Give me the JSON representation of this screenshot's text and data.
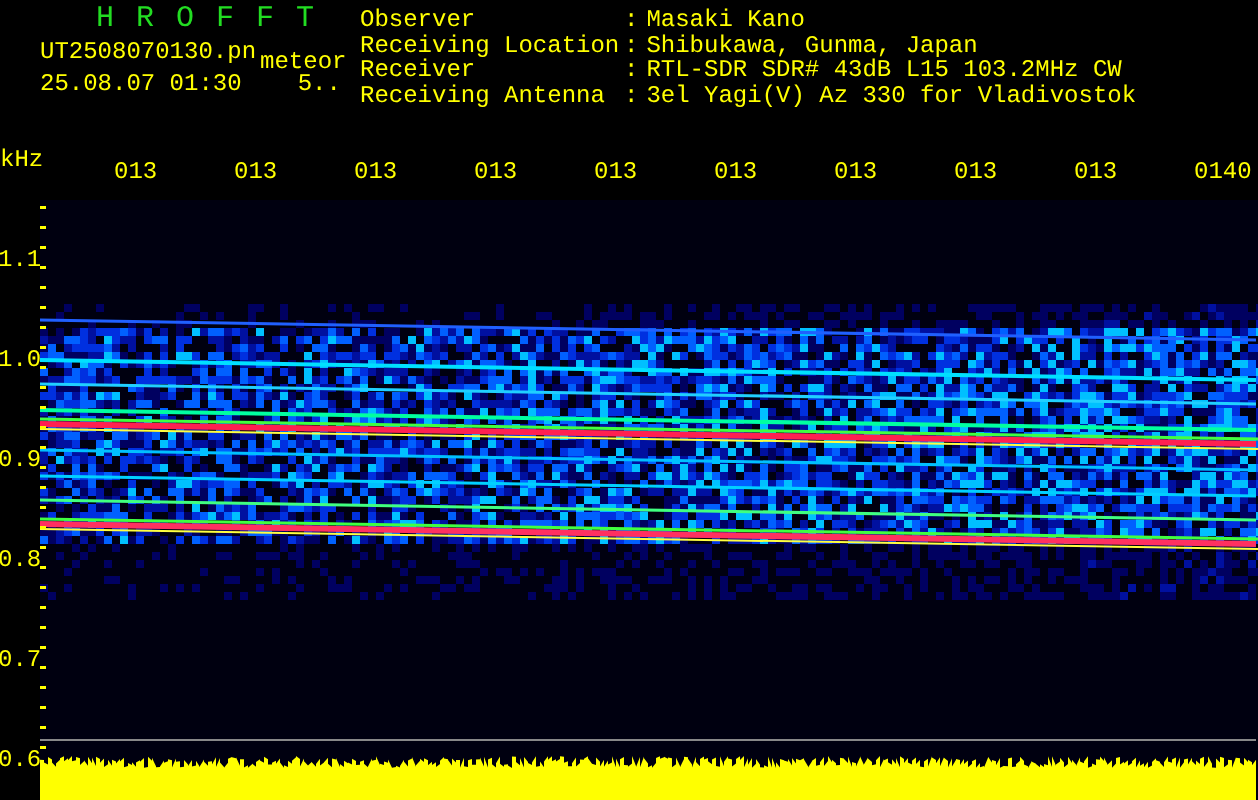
{
  "app_title": "H R O F F T",
  "file_name": "UT2508070130.pn",
  "event_type": "meteor",
  "date_time": "25.08.07 01:30",
  "count": "5..",
  "separator": ":",
  "station_info": [
    {
      "label": "Observer",
      "value": "Masaki Kano"
    },
    {
      "label": "Receiving Location",
      "value": "Shibukawa, Gunma, Japan"
    },
    {
      "label": "Receiver",
      "value": "RTL-SDR SDR# 43dB L15 103.2MHz CW"
    },
    {
      "label": "Receiving Antenna",
      "value": "3el Yagi(V) Az 330 for Vladivostok"
    }
  ],
  "frequency_unit": "kHz",
  "time_labels": [
    "013",
    "013",
    "013",
    "013",
    "013",
    "013",
    "013",
    "013",
    "013",
    "0140"
  ],
  "frequency_labels": [
    "1.1",
    "1.0",
    "0.9",
    "0.8",
    "0.7",
    "0.6"
  ]
}
